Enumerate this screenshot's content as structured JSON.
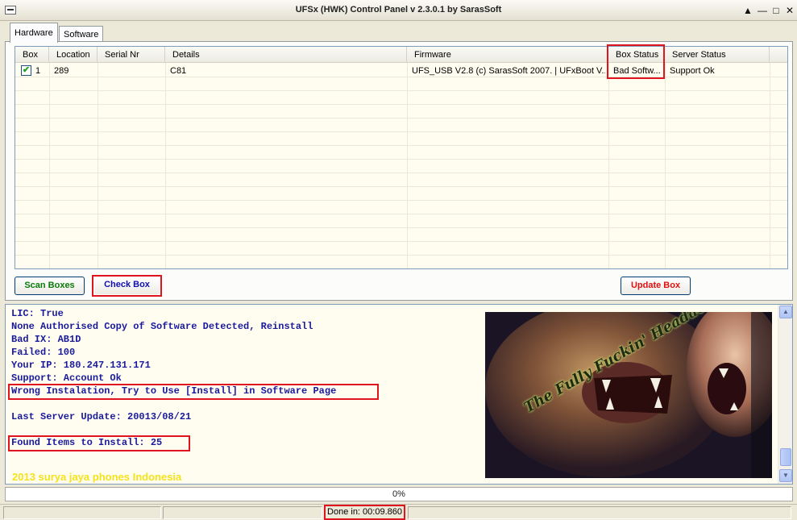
{
  "window": {
    "title": "UFSx (HWK) Control Panel v 2.3.0.1 by SarasSoft",
    "minimize_glyph": "▲",
    "restore_glyph": "—",
    "maximize_glyph": "□",
    "close_glyph": "✕"
  },
  "tabs": [
    {
      "label": "Hardware"
    },
    {
      "label": "Software"
    }
  ],
  "grid": {
    "columns": [
      "Box",
      "Location",
      "Serial Nr",
      "Details",
      "Firmware",
      "Box Status",
      "Server Status"
    ],
    "rows": [
      {
        "checked": true,
        "check_glyph": "✔",
        "box": "1",
        "location": "289",
        "serial": "",
        "details": "C81",
        "firmware": "UFS_USB V2.8 (c) SarasSoft 2007. | UFxBoot V...",
        "box_status": "Bad Softw...",
        "server_status": "Support Ok"
      }
    ]
  },
  "buttons": {
    "scan": "Scan Boxes",
    "check": "Check Box",
    "update": "Update Box"
  },
  "log": {
    "lines": [
      "LIC: True",
      "None Authorised Copy of Software Detected, Reinstall",
      "Bad IX: AB1D",
      "Failed: 100",
      "Your IP: 180.247.131.171",
      "Support: Account Ok",
      "Wrong Instalation, Try to Use [Install] in Software Page",
      "",
      "Last Server Update: 20013/08/21",
      "",
      "Found Items to Install: 25"
    ],
    "credit": "2013 surya jaya phones Indonesia",
    "banner_text": "The Fully Fuckin' Headache Lion"
  },
  "progress": {
    "value": 0,
    "label": "0%"
  },
  "status": {
    "done": "Done in: 00:09.860"
  },
  "colors": {
    "highlight_border": "#e0141e",
    "scan_text": "#0a7a0a",
    "check_text": "#1010b0",
    "update_text": "#e01010",
    "log_text": "#1a1a9c",
    "credit_text": "#f5e21c"
  }
}
